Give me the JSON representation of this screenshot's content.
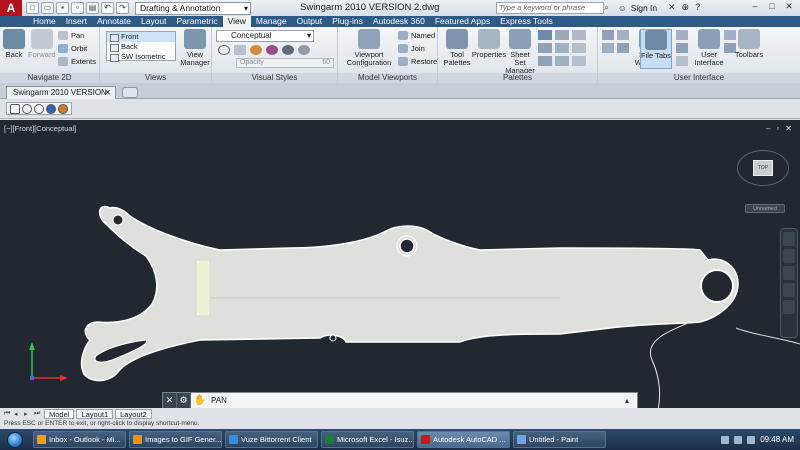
{
  "titlebar": {
    "workspace": "Drafting & Annotation",
    "document_title": "Swingarm 2010 VERSION 2.dwg",
    "search_placeholder": "Type a keyword or phrase",
    "signin_label": "Sign In"
  },
  "ribbon_tabs": [
    "Home",
    "Insert",
    "Annotate",
    "Layout",
    "Parametric",
    "View",
    "Manage",
    "Output",
    "Plug-ins",
    "Autodesk 360",
    "Featured Apps",
    "Express Tools"
  ],
  "active_tab": "View",
  "ribbon": {
    "navigate2d": {
      "title": "Navigate 2D",
      "back_label": "Back",
      "forward_label": "Forward",
      "pan_label": "Pan",
      "orbit_label": "Orbit",
      "extents_label": "Extents"
    },
    "views": {
      "title": "Views",
      "list": [
        "Front",
        "Back",
        "SW Isometric"
      ],
      "selected": "Front",
      "view_manager_label": "View Manager"
    },
    "visual_styles": {
      "title": "Visual Styles",
      "current": "Conceptual",
      "opacity_label": "Opacity",
      "opacity_value": "60"
    },
    "model_viewports": {
      "title": "Model Viewports",
      "viewport_config_label": "Viewport Configuration",
      "named_label": "Named",
      "join_label": "Join",
      "restore_label": "Restore"
    },
    "palettes": {
      "title": "Palettes",
      "tool_palettes_label": "Tool Palettes",
      "properties_label": "Properties",
      "sheet_set_label": "Sheet Set Manager"
    },
    "user_interface": {
      "title": "User Interface",
      "switch_windows_label": "Switch Windows",
      "file_tabs_label": "File Tabs",
      "user_interface_label": "User Interface",
      "toolbars_label": "Toolbars"
    }
  },
  "doc_tab": {
    "label": "Swingarm 2010 VERSION 2*"
  },
  "viewport": {
    "label": "[−][Front][Conceptual]",
    "viewcube_face": "TOP",
    "wcs": "Unnamed"
  },
  "command_line": {
    "text": "PAN"
  },
  "layout_tabs": [
    "Model",
    "Layout1",
    "Layout2"
  ],
  "status_text": "Press ESC or ENTER to exit, or right-click to display shortcut-menu.",
  "taskbar": {
    "items": [
      {
        "label": "Inbox - Outlook - Mi...",
        "color": "#e3a21a"
      },
      {
        "label": "Images to GIF Gener...",
        "color": "#f29111"
      },
      {
        "label": "Vuze Bittorrent Client",
        "color": "#3b8ed8"
      },
      {
        "label": "Microsoft Excel - Isuz...",
        "color": "#1f7a3a"
      },
      {
        "label": "Autodesk AutoCAD ...",
        "color": "#c41a1a"
      },
      {
        "label": "Untitled - Paint",
        "color": "#6fa6e0"
      }
    ],
    "active_index": 4,
    "clock": "09:48 AM"
  },
  "colors": {
    "ribbon_tab_bg": "#2e5a87",
    "viewport_bg": "#212830",
    "part_fill": "#dfe0dc",
    "part_edge": "#ffffff",
    "insert_fill": "#eef0d8"
  }
}
